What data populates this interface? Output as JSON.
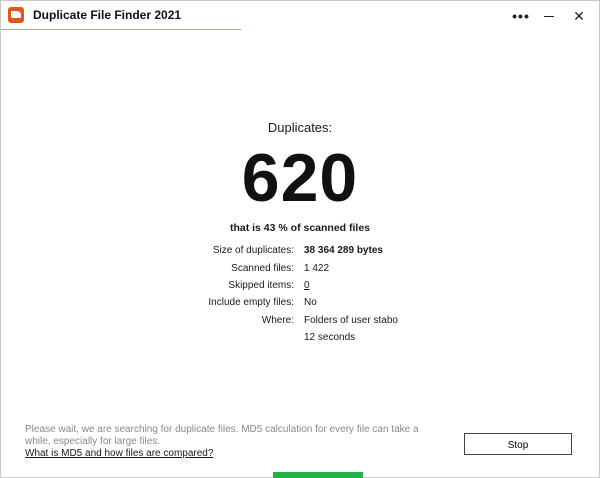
{
  "window": {
    "title": "Duplicate File Finder 2021",
    "more_glyph": "•••",
    "close_glyph": "✕",
    "accent": "#e2571f"
  },
  "summary": {
    "label": "Duplicates:",
    "count": "620",
    "percent_line": "that is 43 % of scanned files"
  },
  "details": [
    {
      "label": "Size of duplicates:",
      "value": "38 364 289 bytes"
    },
    {
      "label": "Scanned files:",
      "value": "1 422"
    },
    {
      "label": "Skipped items:",
      "value": "0"
    },
    {
      "label": "Include empty files:",
      "value": "No"
    },
    {
      "label": "Where:",
      "value": "Folders of user stabo"
    },
    {
      "label": "",
      "value": "12 seconds"
    }
  ],
  "footer": {
    "status": "Please wait, we are searching for duplicate files. MD5 calculation for every file can take a while, especially for large files.",
    "help_link": "What is MD5 and how files are compared?",
    "stop_label": "Stop",
    "progress_color": "#24b34a"
  }
}
